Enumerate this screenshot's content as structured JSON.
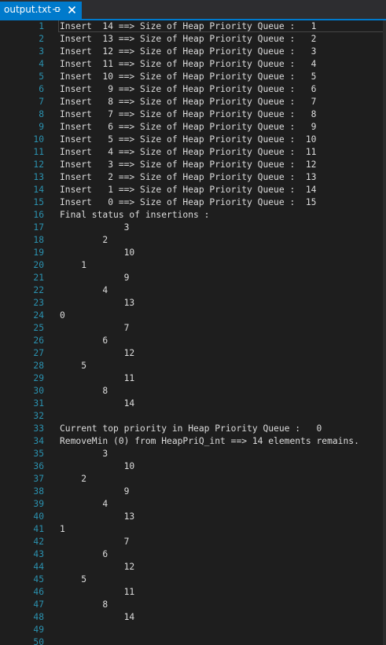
{
  "tab": {
    "title": "output.txt",
    "pin_icon": "pin-icon",
    "close_icon": "close-icon"
  },
  "colors": {
    "background": "#1e1e1e",
    "tab_active": "#007acc",
    "line_numbers": "#2b91af",
    "text": "#dcdcdc"
  },
  "editor": {
    "current_line": 1,
    "lines": [
      {
        "n": "1",
        "text": "Insert  14 ==> Size of Heap Priority Queue :   1"
      },
      {
        "n": "2",
        "text": "Insert  13 ==> Size of Heap Priority Queue :   2"
      },
      {
        "n": "3",
        "text": "Insert  12 ==> Size of Heap Priority Queue :   3"
      },
      {
        "n": "4",
        "text": "Insert  11 ==> Size of Heap Priority Queue :   4"
      },
      {
        "n": "5",
        "text": "Insert  10 ==> Size of Heap Priority Queue :   5"
      },
      {
        "n": "6",
        "text": "Insert   9 ==> Size of Heap Priority Queue :   6"
      },
      {
        "n": "7",
        "text": "Insert   8 ==> Size of Heap Priority Queue :   7"
      },
      {
        "n": "8",
        "text": "Insert   7 ==> Size of Heap Priority Queue :   8"
      },
      {
        "n": "9",
        "text": "Insert   6 ==> Size of Heap Priority Queue :   9"
      },
      {
        "n": "10",
        "text": "Insert   5 ==> Size of Heap Priority Queue :  10"
      },
      {
        "n": "11",
        "text": "Insert   4 ==> Size of Heap Priority Queue :  11"
      },
      {
        "n": "12",
        "text": "Insert   3 ==> Size of Heap Priority Queue :  12"
      },
      {
        "n": "13",
        "text": "Insert   2 ==> Size of Heap Priority Queue :  13"
      },
      {
        "n": "14",
        "text": "Insert   1 ==> Size of Heap Priority Queue :  14"
      },
      {
        "n": "15",
        "text": "Insert   0 ==> Size of Heap Priority Queue :  15"
      },
      {
        "n": "16",
        "text": "Final status of insertions :"
      },
      {
        "n": "17",
        "text": "            3"
      },
      {
        "n": "18",
        "text": "        2"
      },
      {
        "n": "19",
        "text": "            10"
      },
      {
        "n": "20",
        "text": "    1"
      },
      {
        "n": "21",
        "text": "            9"
      },
      {
        "n": "22",
        "text": "        4"
      },
      {
        "n": "23",
        "text": "            13"
      },
      {
        "n": "24",
        "text": "0"
      },
      {
        "n": "25",
        "text": "            7"
      },
      {
        "n": "26",
        "text": "        6"
      },
      {
        "n": "27",
        "text": "            12"
      },
      {
        "n": "28",
        "text": "    5"
      },
      {
        "n": "29",
        "text": "            11"
      },
      {
        "n": "30",
        "text": "        8"
      },
      {
        "n": "31",
        "text": "            14"
      },
      {
        "n": "32",
        "text": ""
      },
      {
        "n": "33",
        "text": "Current top priority in Heap Priority Queue :   0"
      },
      {
        "n": "34",
        "text": "RemoveMin (0) from HeapPriQ_int ==> 14 elements remains."
      },
      {
        "n": "35",
        "text": "        3"
      },
      {
        "n": "36",
        "text": "            10"
      },
      {
        "n": "37",
        "text": "    2"
      },
      {
        "n": "38",
        "text": "            9"
      },
      {
        "n": "39",
        "text": "        4"
      },
      {
        "n": "40",
        "text": "            13"
      },
      {
        "n": "41",
        "text": "1"
      },
      {
        "n": "42",
        "text": "            7"
      },
      {
        "n": "43",
        "text": "        6"
      },
      {
        "n": "44",
        "text": "            12"
      },
      {
        "n": "45",
        "text": "    5"
      },
      {
        "n": "46",
        "text": "            11"
      },
      {
        "n": "47",
        "text": "        8"
      },
      {
        "n": "48",
        "text": "            14"
      },
      {
        "n": "49",
        "text": ""
      },
      {
        "n": "50",
        "text": ""
      }
    ]
  }
}
